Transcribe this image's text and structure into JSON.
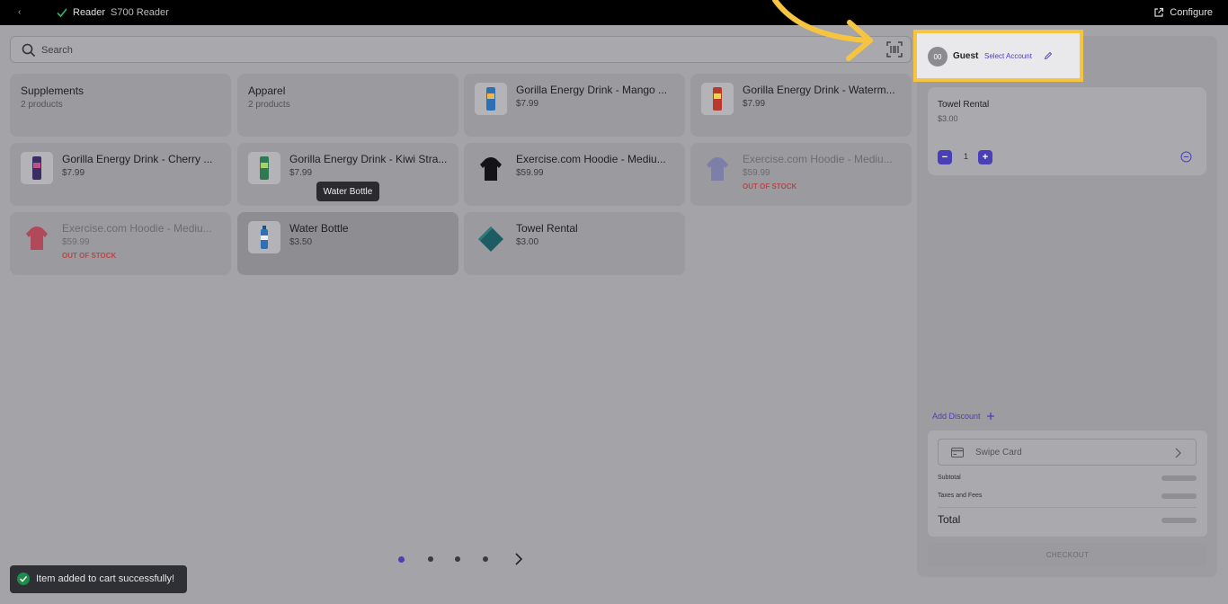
{
  "topbar": {
    "back_icon": "back-icon",
    "status_icon": "check-icon",
    "reader_label": "Reader",
    "reader_name": "S700 Reader",
    "configure_label": "Configure",
    "configure_icon": "external-link-icon"
  },
  "search": {
    "placeholder": "Search",
    "value": "",
    "scan_icon": "barcode-scan-icon"
  },
  "categories": [
    {
      "title": "Supplements",
      "subtitle": "2 products"
    },
    {
      "title": "Apparel",
      "subtitle": "2 products"
    }
  ],
  "products": [
    {
      "name": "Gorilla Energy Drink - Mango ...",
      "price": "$7.99",
      "stock": ""
    },
    {
      "name": "Gorilla Energy Drink - Waterm...",
      "price": "$7.99",
      "stock": ""
    },
    {
      "name": "Gorilla Energy Drink - Cherry ...",
      "price": "$7.99",
      "stock": ""
    },
    {
      "name": "Gorilla Energy Drink - Kiwi Stra...",
      "price": "$7.99",
      "stock": ""
    },
    {
      "name": "Exercise.com Hoodie - Mediu...",
      "price": "$59.99",
      "stock": ""
    },
    {
      "name": "Exercise.com Hoodie - Mediu...",
      "price": "$59.99",
      "stock": "OUT OF STOCK"
    },
    {
      "name": "Exercise.com Hoodie - Mediu...",
      "price": "$59.99",
      "stock": "OUT OF STOCK"
    },
    {
      "name": "Water Bottle",
      "price": "$3.50",
      "stock": ""
    },
    {
      "name": "Towel Rental",
      "price": "$3.00",
      "stock": ""
    }
  ],
  "tooltip": "Water Bottle",
  "pagination": {
    "pages": 4,
    "current": 1
  },
  "toast": {
    "message": "Item added to cart successfully!"
  },
  "account": {
    "initials": "00",
    "name": "Guest",
    "select_label": "Select Account"
  },
  "cart": {
    "items": [
      {
        "name": "Towel Rental",
        "price": "$3.00",
        "quantity": "1"
      }
    ],
    "add_discount_label": "Add Discount",
    "swipe_label": "Swipe Card",
    "subtotal_label": "Subtotal",
    "taxes_label": "Taxes and Fees",
    "total_label": "Total",
    "checkout_label": "CHECKOUT"
  },
  "colors": {
    "accent": "#4b3fb8",
    "highlight": "#f5c542",
    "out_of_stock": "#b44a4a",
    "success": "#1f8a4b"
  }
}
